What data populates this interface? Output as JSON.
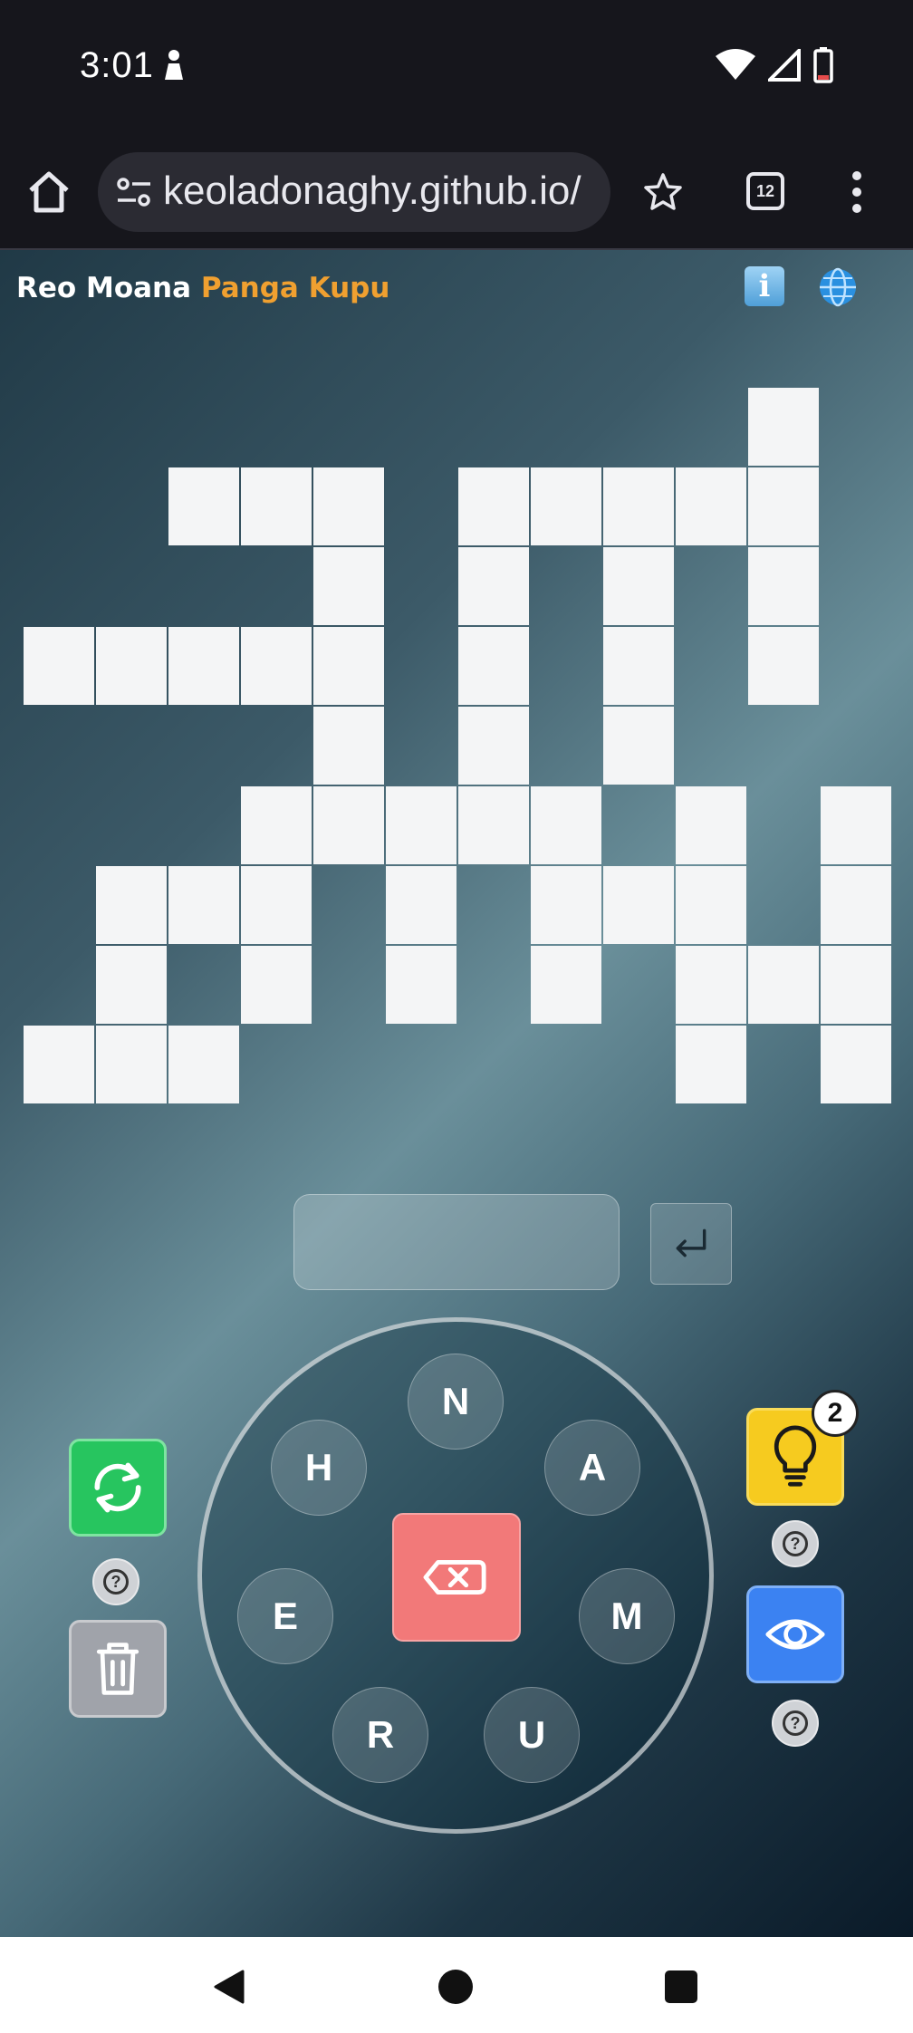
{
  "status_bar": {
    "time": "3:01"
  },
  "browser": {
    "url": "keoladonaghy.github.io/",
    "tab_count": "12"
  },
  "game": {
    "title_part1": "Reo Moana",
    "title_part2": "Panga Kupu",
    "info_icon": "i",
    "letters": [
      "N",
      "A",
      "M",
      "U",
      "R",
      "E",
      "H"
    ],
    "hint_count": "2",
    "help_label": "?",
    "colors": {
      "accent": "#f0a030",
      "shuffle": "#27c55f",
      "hint": "#f6cb1f",
      "reveal": "#3b82f2",
      "delete": "#f27979"
    }
  }
}
